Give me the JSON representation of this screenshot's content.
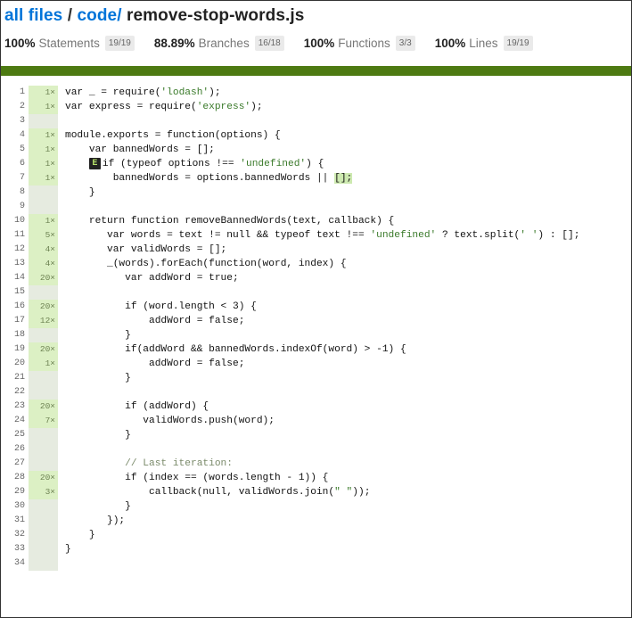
{
  "breadcrumb": {
    "root": "all files",
    "sep1": " / ",
    "dir": "code/",
    "file": "remove-stop-words.js"
  },
  "stats": [
    {
      "pct": "100%",
      "label": "Statements",
      "frac": "19/19"
    },
    {
      "pct": "88.89%",
      "label": "Branches",
      "frac": "16/18"
    },
    {
      "pct": "100%",
      "label": "Functions",
      "frac": "3/3"
    },
    {
      "pct": "100%",
      "label": "Lines",
      "frac": "19/19"
    }
  ],
  "colors": {
    "status_bar": "#4d7a12",
    "link": "#0074d9",
    "count_bg": "#dcf0c4"
  },
  "branch_marker": "E",
  "lines": [
    {
      "n": "1",
      "c": "1×",
      "code": "var _ = require('lodash');"
    },
    {
      "n": "2",
      "c": "1×",
      "code": "var express = require('express');"
    },
    {
      "n": "3",
      "c": "",
      "code": ""
    },
    {
      "n": "4",
      "c": "1×",
      "code": "module.exports = function(options) {"
    },
    {
      "n": "5",
      "c": "1×",
      "code": "    var bannedWords = [];"
    },
    {
      "n": "6",
      "c": "1×",
      "code": "if (typeof options !== 'undefined') {"
    },
    {
      "n": "7",
      "c": "1×",
      "code": "        bannedWords = options.bannedWords || ",
      "tail": "[];"
    },
    {
      "n": "8",
      "c": "",
      "code": "    }"
    },
    {
      "n": "9",
      "c": "",
      "code": ""
    },
    {
      "n": "10",
      "c": "1×",
      "code": "    return function removeBannedWords(text, callback) {"
    },
    {
      "n": "11",
      "c": "5×",
      "code": "       var words = text != null && typeof text !== 'undefined' ? text.split(' ') : [];"
    },
    {
      "n": "12",
      "c": "4×",
      "code": "       var validWords = [];"
    },
    {
      "n": "13",
      "c": "4×",
      "code": "       _(words).forEach(function(word, index) {"
    },
    {
      "n": "14",
      "c": "20×",
      "code": "          var addWord = true;"
    },
    {
      "n": "15",
      "c": "",
      "code": ""
    },
    {
      "n": "16",
      "c": "20×",
      "code": "          if (word.length < 3) {"
    },
    {
      "n": "17",
      "c": "12×",
      "code": "              addWord = false;"
    },
    {
      "n": "18",
      "c": "",
      "code": "          }"
    },
    {
      "n": "19",
      "c": "20×",
      "code": "          if(addWord && bannedWords.indexOf(word) > -1) {"
    },
    {
      "n": "20",
      "c": "1×",
      "code": "              addWord = false;"
    },
    {
      "n": "21",
      "c": "",
      "code": "          }"
    },
    {
      "n": "22",
      "c": "",
      "code": ""
    },
    {
      "n": "23",
      "c": "20×",
      "code": "          if (addWord) {"
    },
    {
      "n": "24",
      "c": "7×",
      "code": "             validWords.push(word);"
    },
    {
      "n": "25",
      "c": "",
      "code": "          }"
    },
    {
      "n": "26",
      "c": "",
      "code": ""
    },
    {
      "n": "27",
      "c": "",
      "code": "          // Last iteration:"
    },
    {
      "n": "28",
      "c": "20×",
      "code": "          if (index == (words.length - 1)) {"
    },
    {
      "n": "29",
      "c": "3×",
      "code": "              callback(null, validWords.join(\" \"));"
    },
    {
      "n": "30",
      "c": "",
      "code": "          }"
    },
    {
      "n": "31",
      "c": "",
      "code": "       });"
    },
    {
      "n": "32",
      "c": "",
      "code": "    }"
    },
    {
      "n": "33",
      "c": "",
      "code": "}"
    },
    {
      "n": "34",
      "c": "",
      "code": ""
    }
  ]
}
